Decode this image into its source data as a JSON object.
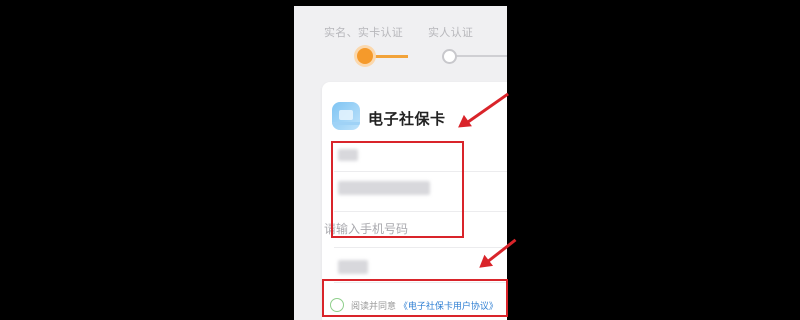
{
  "steps": {
    "step1_label": "实名、实卡认证",
    "step2_label": "实人认证",
    "active_step": 1,
    "colors": {
      "active": "#f59a2b",
      "inactive": "#c8c8cc"
    }
  },
  "card": {
    "title": "电子社保卡",
    "icon": "social-security-card-icon",
    "phone_input_placeholder": "请输入手机号码",
    "agreement": {
      "prefix": "阅读并同意",
      "link": "《电子社保卡用户协议》"
    }
  },
  "annotations": {
    "highlight_color": "#d9242a"
  }
}
